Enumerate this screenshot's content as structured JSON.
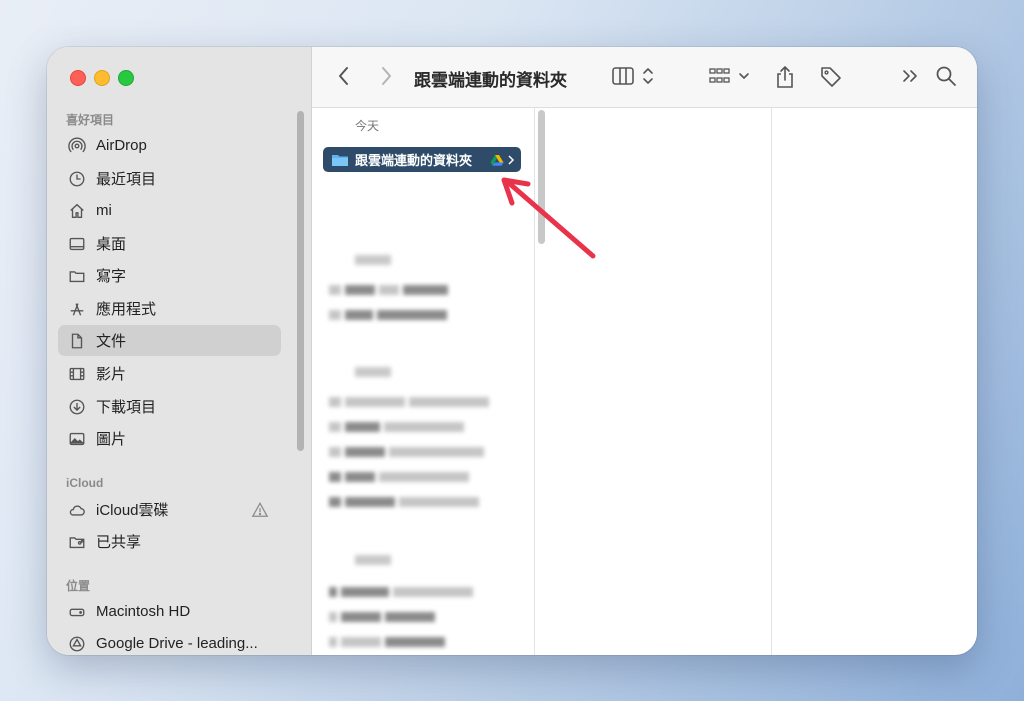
{
  "sidebar": {
    "favorites_title": "喜好項目",
    "favorites": [
      {
        "label": "AirDrop",
        "icon": "airdrop-icon"
      },
      {
        "label": "最近項目",
        "icon": "clock-icon"
      },
      {
        "label": "mi",
        "icon": "home-icon"
      },
      {
        "label": "桌面",
        "icon": "desktop-icon"
      },
      {
        "label": "寫字",
        "icon": "folder-icon"
      },
      {
        "label": "應用程式",
        "icon": "applications-icon"
      },
      {
        "label": "文件",
        "icon": "document-icon",
        "selected": true
      },
      {
        "label": "影片",
        "icon": "film-icon"
      },
      {
        "label": "下載項目",
        "icon": "download-icon"
      },
      {
        "label": "圖片",
        "icon": "photo-icon"
      }
    ],
    "icloud_title": "iCloud",
    "icloud": [
      {
        "label": "iCloud雲碟",
        "icon": "cloud-icon",
        "warning": true
      },
      {
        "label": "已共享",
        "icon": "shared-folder-icon"
      }
    ],
    "locations_title": "位置",
    "locations": [
      {
        "label": "Macintosh HD",
        "icon": "harddisk-icon"
      },
      {
        "label": "Google Drive - leading...",
        "icon": "drive-icon"
      }
    ]
  },
  "toolbar": {
    "title": "跟雲端連動的資料夾"
  },
  "column1": {
    "group_today": "今天",
    "selected_item": "跟雲端連動的資料夾",
    "selected_item_icon": "google-drive-icon"
  },
  "colors": {
    "selection": "#2e4c6a",
    "annotation_arrow": "#e8334a",
    "folder": "#5fb4f0"
  }
}
